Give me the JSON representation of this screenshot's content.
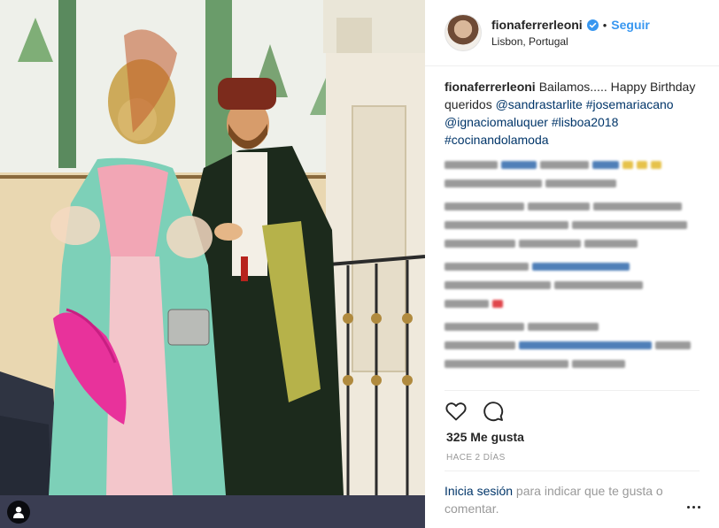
{
  "post": {
    "username": "fionaferrerleoni",
    "follow_label": "Seguir",
    "separator": "•",
    "location": "Lisbon, Portugal"
  },
  "caption": {
    "username": "fionaferrerleoni",
    "text_1": "Bailamos..... Happy Birthday queridos ",
    "mention_1": "@sandrastarlite",
    "hashtag_1": "#josemariacano",
    "mention_2": "@ignaciomaluquer",
    "hashtag_2": "#lisboa2018",
    "hashtag_3": "#cocinandolamoda"
  },
  "actions": {
    "like_icon": "heart-icon",
    "comment_icon": "comment-icon"
  },
  "stats": {
    "likes": "325 Me gusta",
    "timestamp": "HACE 2 DÍAS"
  },
  "login": {
    "link": "Inicia sesión",
    "rest": " para indicar que te gusta o comentar."
  },
  "colors": {
    "link_blue": "#3897f0",
    "hashtag_navy": "#003569",
    "muted_gray": "#999999",
    "text_dark": "#262626"
  }
}
